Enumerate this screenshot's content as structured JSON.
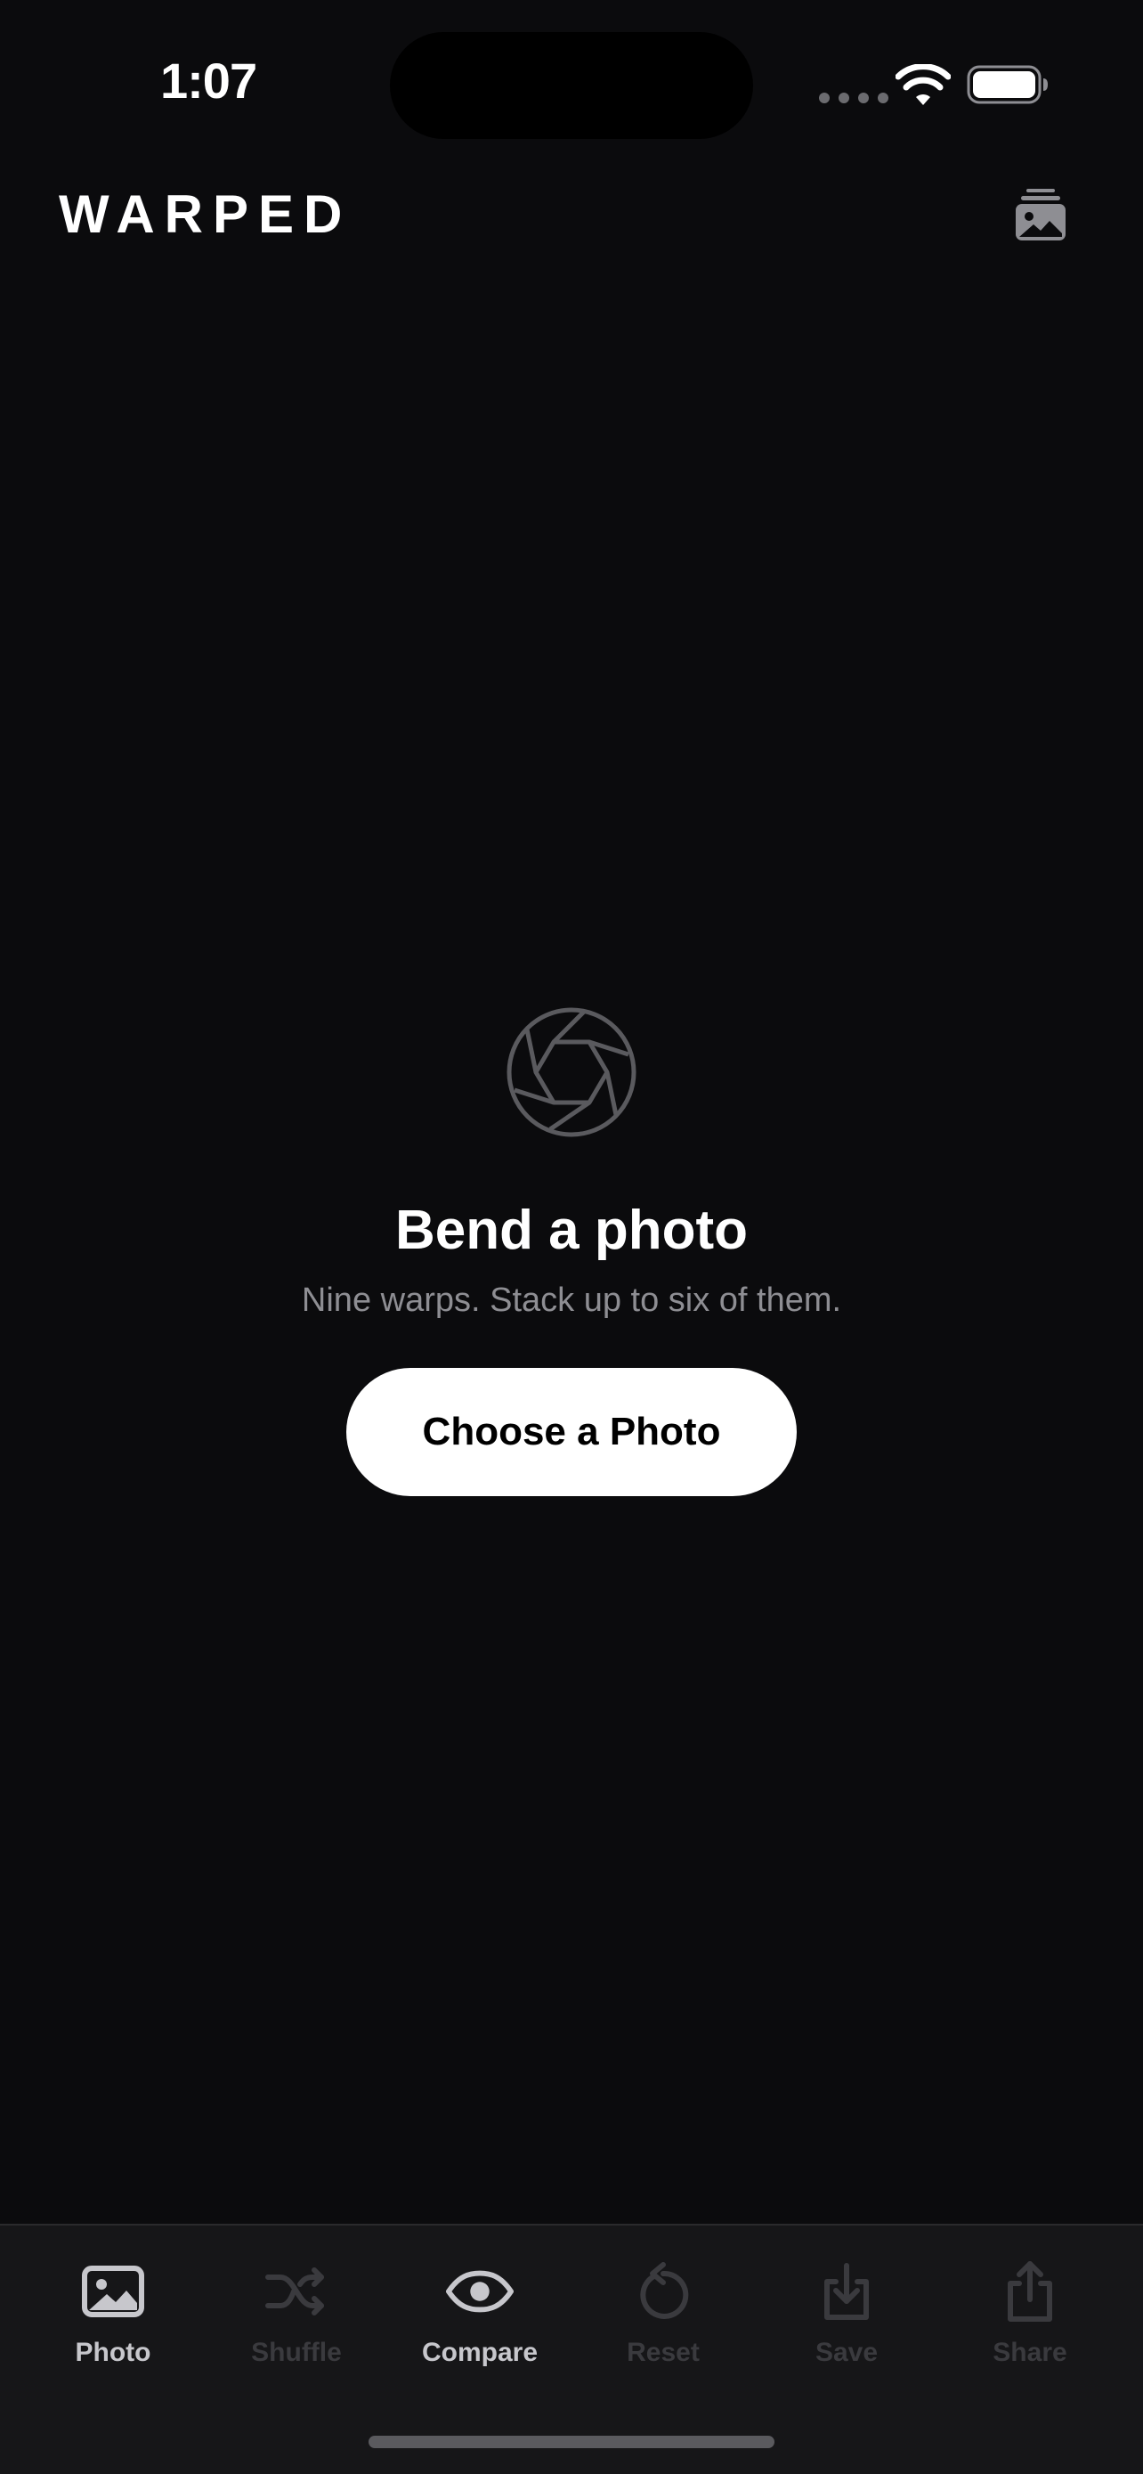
{
  "status_bar": {
    "time": "1:07"
  },
  "header": {
    "title": "WARPED",
    "gallery_icon": "photo-stack-icon"
  },
  "empty_state": {
    "icon": "aperture-icon",
    "title": "Bend a photo",
    "subtitle": "Nine warps. Stack up to six of them.",
    "button_label": "Choose a Photo"
  },
  "tab_bar": {
    "tabs": [
      {
        "label": "Photo",
        "icon": "photo-icon",
        "enabled": true
      },
      {
        "label": "Shuffle",
        "icon": "shuffle-icon",
        "enabled": false
      },
      {
        "label": "Compare",
        "icon": "eye-icon",
        "enabled": true
      },
      {
        "label": "Reset",
        "icon": "reset-icon",
        "enabled": false
      },
      {
        "label": "Save",
        "icon": "download-icon",
        "enabled": false
      },
      {
        "label": "Share",
        "icon": "share-icon",
        "enabled": false
      }
    ]
  },
  "colors": {
    "background": "#0b0b0d",
    "tab_bar": "#161618",
    "button": "#ffffff",
    "subtitle": "#8e8e93",
    "tab_enabled": "#c7c7cc",
    "tab_disabled": "#3a3a3e"
  }
}
